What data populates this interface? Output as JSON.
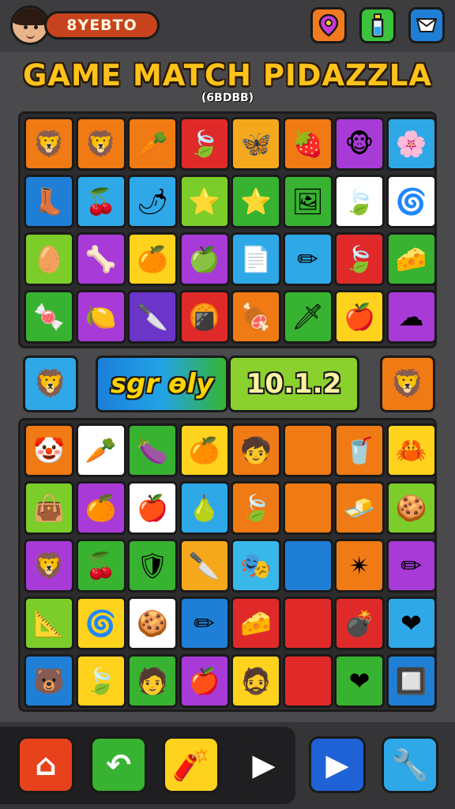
{
  "header": {
    "player_name": "8YEBTO",
    "icons": [
      "map-pin-icon",
      "potion-icon",
      "mail-icon"
    ]
  },
  "title": "GAME MATCH PIDAZZLA",
  "subtitle": "(6BDBB)",
  "board_top": {
    "rows": [
      [
        {
          "icon": "lion-icon",
          "glyph": "🦁",
          "color": "#f07a14"
        },
        {
          "icon": "lion-icon",
          "glyph": "🦁",
          "color": "#f07a14"
        },
        {
          "icon": "carrot-icon",
          "glyph": "🥕",
          "color": "#f07a14"
        },
        {
          "icon": "leaf-icon",
          "glyph": "🍃",
          "color": "#e02a2a"
        },
        {
          "icon": "butterfly-icon",
          "glyph": "🦋",
          "color": "#f5a81c"
        },
        {
          "icon": "strawberry-icon",
          "glyph": "🍓",
          "color": "#f07a14"
        },
        {
          "icon": "monkey-icon",
          "glyph": "🐵",
          "color": "#a83bd8"
        },
        {
          "icon": "flower-icon",
          "glyph": "🌸",
          "color": "#2fa8e8"
        }
      ],
      [
        {
          "icon": "boot-icon",
          "glyph": "👢",
          "color": "#1f7fd6"
        },
        {
          "icon": "cherry-icon",
          "glyph": "🍒",
          "color": "#2fa8e8"
        },
        {
          "icon": "pepper-icon",
          "glyph": "🌶",
          "color": "#2fa8e8"
        },
        {
          "icon": "star-icon",
          "glyph": "⭐",
          "color": "#7ccd2a"
        },
        {
          "icon": "star-icon",
          "glyph": "⭐",
          "color": "#38b231"
        },
        {
          "icon": "picture-icon",
          "glyph": "🖼",
          "color": "#38b231"
        },
        {
          "icon": "leaf-icon",
          "glyph": "🍃",
          "color": "#ffffff"
        },
        {
          "icon": "spiral-icon",
          "glyph": "🌀",
          "color": "#ffffff"
        }
      ],
      [
        {
          "icon": "egg-icon",
          "glyph": "🥚",
          "color": "#7ccd2a"
        },
        {
          "icon": "bone-icon",
          "glyph": "🦴",
          "color": "#a83bd8"
        },
        {
          "icon": "orange-icon",
          "glyph": "🍊",
          "color": "#ffd21e"
        },
        {
          "icon": "apple-icon",
          "glyph": "🍏",
          "color": "#a83bd8"
        },
        {
          "icon": "paper-icon",
          "glyph": "📄",
          "color": "#2fa8e8"
        },
        {
          "icon": "pencil-icon",
          "glyph": "✏",
          "color": "#2fa8e8"
        },
        {
          "icon": "leaf-icon",
          "glyph": "🍃",
          "color": "#e02a2a"
        },
        {
          "icon": "cheese-icon",
          "glyph": "🧀",
          "color": "#38b231"
        }
      ],
      [
        {
          "icon": "candy-icon",
          "glyph": "🍬",
          "color": "#38b231"
        },
        {
          "icon": "lemon-icon",
          "glyph": "🍋",
          "color": "#a83bd8"
        },
        {
          "icon": "knife-icon",
          "glyph": "🔪",
          "color": "#6a35c8"
        },
        {
          "icon": "cracker-icon",
          "glyph": "🍘",
          "color": "#e02a2a"
        },
        {
          "icon": "meat-icon",
          "glyph": "🍖",
          "color": "#f07a14"
        },
        {
          "icon": "sword-icon",
          "glyph": "🗡",
          "color": "#38b231"
        },
        {
          "icon": "apple-icon",
          "glyph": "🍎",
          "color": "#ffd21e"
        },
        {
          "icon": "cloud-icon",
          "glyph": "☁",
          "color": "#a83bd8"
        }
      ]
    ]
  },
  "mid_row": {
    "left_tile": {
      "icon": "lion-icon",
      "glyph": "🦁",
      "color": "#2fa8e8"
    },
    "panel_left": "sgr ѳly",
    "panel_right": "10.1.2",
    "right_tile": {
      "icon": "lion-icon",
      "glyph": "🦁",
      "color": "#f07a14"
    }
  },
  "board_bottom": {
    "rows": [
      [
        {
          "icon": "clown-icon",
          "glyph": "🤡",
          "color": "#f07a14"
        },
        {
          "icon": "carrot-icon",
          "glyph": "🥕",
          "color": "#ffffff"
        },
        {
          "icon": "eggplant-icon",
          "glyph": "🍆",
          "color": "#38b231"
        },
        {
          "icon": "orange-icon",
          "glyph": "🍊",
          "color": "#ffd21e"
        },
        {
          "icon": "face-icon",
          "glyph": "🧒",
          "color": "#f07a14"
        },
        {
          "icon": "blank-icon",
          "glyph": "",
          "color": "#f07a14"
        },
        {
          "icon": "cup-icon",
          "glyph": "🥤",
          "color": "#f07a14"
        },
        {
          "icon": "starfish-icon",
          "glyph": "🦀",
          "color": "#ffd21e"
        }
      ],
      [
        {
          "icon": "bag-icon",
          "glyph": "👜",
          "color": "#7ccd2a"
        },
        {
          "icon": "orange-icon",
          "glyph": "🍊",
          "color": "#a83bd8"
        },
        {
          "icon": "apple-icon",
          "glyph": "🍎",
          "color": "#ffffff"
        },
        {
          "icon": "pear-icon",
          "glyph": "🍐",
          "color": "#2fa8e8"
        },
        {
          "icon": "leaf-icon",
          "glyph": "🍃",
          "color": "#f07a14"
        },
        {
          "icon": "blank-icon",
          "glyph": "",
          "color": "#f07a14"
        },
        {
          "icon": "butter-icon",
          "glyph": "🧈",
          "color": "#f07a14"
        },
        {
          "icon": "cookie-icon",
          "glyph": "🍪",
          "color": "#7ccd2a"
        }
      ],
      [
        {
          "icon": "lion-icon",
          "glyph": "🦁",
          "color": "#a83bd8"
        },
        {
          "icon": "cherry-icon",
          "glyph": "🍒",
          "color": "#38b231"
        },
        {
          "icon": "shield-icon",
          "glyph": "🛡",
          "color": "#38b231"
        },
        {
          "icon": "knife-icon",
          "glyph": "🔪",
          "color": "#f5a81c"
        },
        {
          "icon": "mask-icon",
          "glyph": "🎭",
          "color": "#38b8e8"
        },
        {
          "icon": "blank-icon",
          "glyph": "",
          "color": "#1f7fd6"
        },
        {
          "icon": "starfish-icon",
          "glyph": "✴",
          "color": "#f07a14"
        },
        {
          "icon": "pencil-icon",
          "glyph": "✏",
          "color": "#a83bd8"
        }
      ],
      [
        {
          "icon": "triangle-icon",
          "glyph": "📐",
          "color": "#7ccd2a"
        },
        {
          "icon": "spiral-icon",
          "glyph": "🌀",
          "color": "#ffd21e"
        },
        {
          "icon": "cookie-icon",
          "glyph": "🍪",
          "color": "#ffffff"
        },
        {
          "icon": "pencil-icon",
          "glyph": "✏",
          "color": "#1f7fd6"
        },
        {
          "icon": "cheese-icon",
          "glyph": "🧀",
          "color": "#e02a2a"
        },
        {
          "icon": "blank-icon",
          "glyph": "",
          "color": "#e02a2a"
        },
        {
          "icon": "bomb-icon",
          "glyph": "💣",
          "color": "#e02a2a"
        },
        {
          "icon": "heart-icon",
          "glyph": "❤",
          "color": "#2fa8e8"
        }
      ],
      [
        {
          "icon": "bear-icon",
          "glyph": "🐻",
          "color": "#1f7fd6"
        },
        {
          "icon": "leaf-icon",
          "glyph": "🍃",
          "color": "#ffd21e"
        },
        {
          "icon": "face-icon",
          "glyph": "🧑",
          "color": "#38b231"
        },
        {
          "icon": "apple-icon",
          "glyph": "🍎",
          "color": "#a83bd8"
        },
        {
          "icon": "face-icon",
          "glyph": "🧔",
          "color": "#ffd21e"
        },
        {
          "icon": "blank-icon",
          "glyph": "",
          "color": "#e02a2a"
        },
        {
          "icon": "heart-icon",
          "glyph": "❤",
          "color": "#38b231"
        },
        {
          "icon": "frame-icon",
          "glyph": "🔲",
          "color": "#1f7fd6"
        }
      ]
    ]
  },
  "toolbar": {
    "buttons": [
      {
        "icon": "home-icon",
        "glyph": "⌂",
        "color": "#e8421c"
      },
      {
        "icon": "undo-icon",
        "glyph": "↶",
        "color": "#38b231"
      },
      {
        "icon": "bomb-icon",
        "glyph": "🧨",
        "color": "#ffd21e"
      },
      {
        "icon": "play-icon",
        "glyph": "▶",
        "color": "#1f1f21"
      },
      {
        "icon": "play-icon",
        "glyph": "▶",
        "color": "#1f62d6"
      },
      {
        "icon": "wrench-icon",
        "glyph": "🔧",
        "color": "#2fa8e8"
      }
    ]
  }
}
